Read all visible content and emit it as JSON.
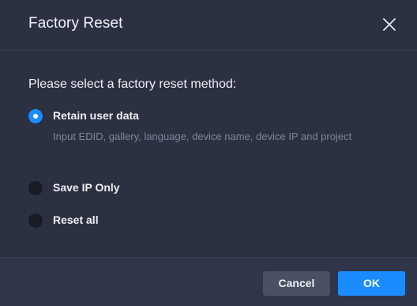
{
  "dialog": {
    "title": "Factory Reset",
    "prompt": "Please select a factory reset method:",
    "options": [
      {
        "label": "Retain user data",
        "description": "Input EDID, gallery, language, device name, device IP and project",
        "selected": true
      },
      {
        "label": "Save IP Only",
        "selected": false
      },
      {
        "label": "Reset all",
        "selected": false
      }
    ],
    "buttons": {
      "cancel": "Cancel",
      "ok": "OK"
    }
  },
  "colors": {
    "background": "#2c3142",
    "accent": "#1a8cff",
    "text": "#f0f1f4",
    "muted_text": "#7f8597"
  },
  "icons": {
    "close": "close-icon"
  }
}
